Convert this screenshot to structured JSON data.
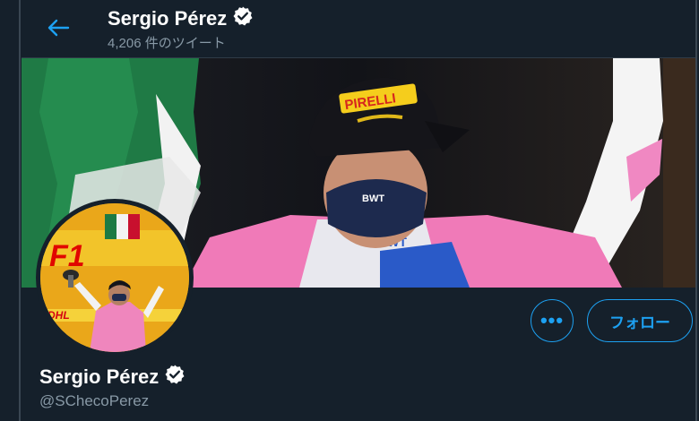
{
  "header": {
    "display_name": "Sergio Pérez",
    "tweet_count": "4,206 件のツイート"
  },
  "profile": {
    "display_name": "Sergio Pérez",
    "handle": "@SChecoPerez"
  },
  "actions": {
    "more_label": "•••",
    "follow_label": "フォロー"
  },
  "banner": {
    "cap_text": "PIRELLI",
    "mask_text": "BWT",
    "suit_text": "BWT"
  },
  "avatar": {
    "logo_text": "F1",
    "sponsor_text": "DHL"
  },
  "colors": {
    "background": "#15202b",
    "accent": "#1da1f2",
    "secondary_text": "#8899a6"
  }
}
